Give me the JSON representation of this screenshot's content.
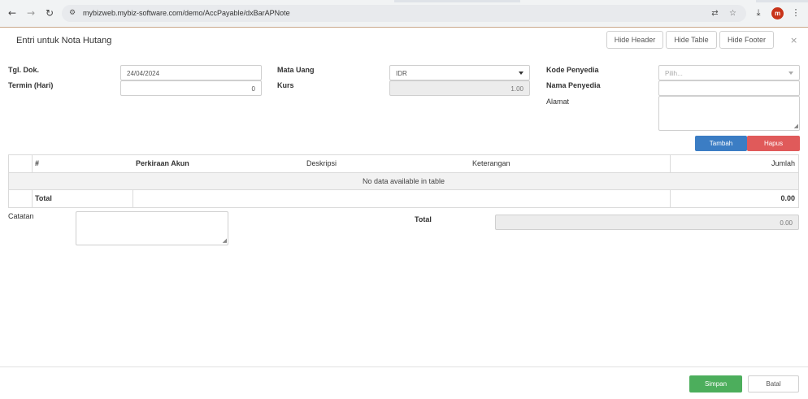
{
  "browser": {
    "url": "mybizweb.mybiz-software.com/demo/AccPayable/dxBarAPNote",
    "avatar_letter": "m",
    "icons": [
      "back-icon",
      "forward-icon",
      "reload-icon",
      "site-settings-icon",
      "translate-icon",
      "bookmark-star-icon",
      "download-icon",
      "kebab-menu-icon"
    ]
  },
  "modal": {
    "title": "Entri untuk Nota Hutang",
    "buttons": {
      "hide_header": "Hide Header",
      "hide_table": "Hide Table",
      "hide_footer": "Hide Footer"
    },
    "close": "×"
  },
  "form": {
    "tgl_dok": {
      "label": "Tgl. Dok.",
      "value": "24/04/2024"
    },
    "termin": {
      "label": "Termin (Hari)",
      "value": "0"
    },
    "mata_uang": {
      "label": "Mata Uang",
      "value": "IDR"
    },
    "kurs": {
      "label": "Kurs",
      "value": "1.00"
    },
    "kode_penyedia": {
      "label": "Kode Penyedia",
      "placeholder": "Pilih..."
    },
    "nama_penyedia": {
      "label": "Nama Penyedia",
      "value": ""
    },
    "alamat": {
      "label": "Alamat",
      "value": ""
    }
  },
  "actions": {
    "tambah": "Tambah",
    "hapus": "Hapus",
    "tambah_color": "#3b7dc4",
    "hapus_color": "#e05a5a"
  },
  "table": {
    "columns": [
      "#",
      "Perkiraan Akun",
      "Deskripsi",
      "Keterangan",
      "Jumlah"
    ],
    "empty_message": "No data available in table",
    "footer_label": "Total",
    "footer_value": "0.00"
  },
  "bottom": {
    "catatan_label": "Catatan",
    "total_label": "Total",
    "total_value": "0.00"
  },
  "footer": {
    "simpan": "Simpan",
    "batal": "Batal",
    "simpan_color": "#4cae5c"
  }
}
